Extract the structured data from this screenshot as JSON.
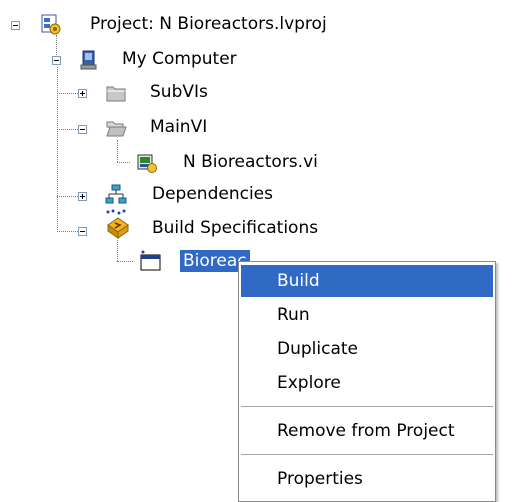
{
  "tree": {
    "items": [
      {
        "label": "Project: N Bioreactors.lvproj",
        "icon": "project-icon"
      },
      {
        "label": "My Computer",
        "icon": "computer-icon"
      },
      {
        "label": "SubVIs",
        "icon": "folder-icon"
      },
      {
        "label": "MainVI",
        "icon": "folder-icon"
      },
      {
        "label": "N Bioreactors.vi",
        "icon": "vi-file-icon"
      },
      {
        "label": "Dependencies",
        "icon": "dependencies-icon"
      },
      {
        "label": "Build Specifications",
        "icon": "build-specifications-icon"
      },
      {
        "label": "Bioreac",
        "icon": "application-build-icon",
        "selected": true
      }
    ]
  },
  "context_menu": {
    "items": [
      {
        "label": "Build",
        "highlighted": true
      },
      {
        "label": "Run"
      },
      {
        "label": "Duplicate"
      },
      {
        "label": "Explore"
      },
      {
        "label": "Remove from Project"
      },
      {
        "label": "Properties"
      }
    ]
  },
  "colors": {
    "selection": "#316ac5",
    "folder": "#c0c0c0",
    "tree_lines": "#7f7f7f"
  }
}
